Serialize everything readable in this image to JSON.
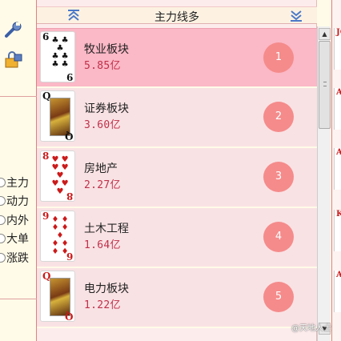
{
  "header": {
    "title": "主力线多"
  },
  "rows": [
    {
      "name": "牧业板块",
      "value": "5.85亿",
      "rank": "1",
      "card_rank": "6",
      "card_rank_bottom": "9",
      "card_suit": "♣",
      "card_color": "black",
      "card_pips": "♣ ♣\n♣\n♣ ♣\n♣ ♣",
      "face": false,
      "selected": true
    },
    {
      "name": "证券板块",
      "value": "3.60亿",
      "rank": "2",
      "card_rank": "Q",
      "card_rank_bottom": "Q",
      "card_suit": "♣",
      "card_color": "black",
      "face": true,
      "selected": false
    },
    {
      "name": "房地产",
      "value": "2.27亿",
      "rank": "3",
      "card_rank": "8",
      "card_rank_bottom": "8",
      "card_suit": "♥",
      "card_color": "red",
      "card_pips": "♥ ♥\n♥ ♥\n♥\n♥ ♥\n♥",
      "face": false,
      "selected": false
    },
    {
      "name": "土木工程",
      "value": "1.64亿",
      "rank": "4",
      "card_rank": "9",
      "card_rank_bottom": "6",
      "card_suit": "♦",
      "card_color": "red",
      "card_pips": "♦ ♦\n♦ ♦\n♦\n♦ ♦\n♦ ♦",
      "face": false,
      "selected": false
    },
    {
      "name": "电力板块",
      "value": "1.22亿",
      "rank": "5",
      "card_rank": "Q",
      "card_rank_bottom": "Q",
      "card_suit": "♥",
      "card_color": "red",
      "face": true,
      "selected": false
    }
  ],
  "options": [
    "主力",
    "动力",
    "内外",
    "大单",
    "涨跌"
  ],
  "right_panel": {
    "cards": [
      "JOKER",
      "A",
      "A",
      "K",
      "A"
    ]
  },
  "watermark": "@天地人士",
  "colors": {
    "selected_row": "#fbb8c6",
    "row": "#f9e2e4",
    "rank_badge": "#f58b8b",
    "value_text": "#c0304a",
    "frame_line": "#e08080"
  },
  "icons": {
    "tool": "wrench-icon",
    "lock": "lock-icon",
    "sort_up": "double-chevron-up-icon",
    "sort_down": "double-chevron-down-icon"
  }
}
